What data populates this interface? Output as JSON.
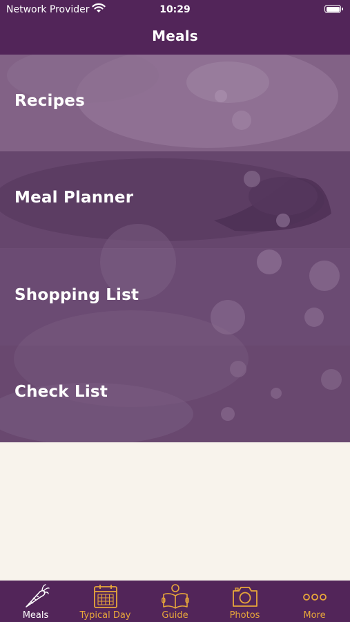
{
  "status_bar": {
    "carrier": "Network Provider",
    "time": "10:29"
  },
  "header": {
    "title": "Meals"
  },
  "menu": {
    "items": [
      {
        "label": "Recipes"
      },
      {
        "label": "Meal Planner"
      },
      {
        "label": "Shopping List"
      },
      {
        "label": "Check List"
      }
    ]
  },
  "tab_bar": {
    "tabs": [
      {
        "label": "Meals",
        "icon": "carrot-icon",
        "active": true
      },
      {
        "label": "Typical Day",
        "icon": "calendar-icon",
        "active": false
      },
      {
        "label": "Guide",
        "icon": "reading-person-icon",
        "active": false
      },
      {
        "label": "Photos",
        "icon": "camera-icon",
        "active": false
      },
      {
        "label": "More",
        "icon": "more-dots-icon",
        "active": false
      }
    ]
  },
  "colors": {
    "brand_purple": "#522559",
    "accent_gold": "#e8a73a",
    "background_cream": "#f8f3ec"
  }
}
